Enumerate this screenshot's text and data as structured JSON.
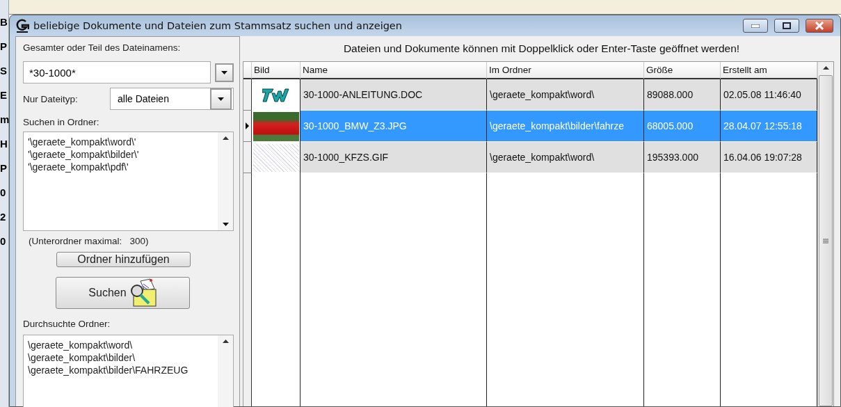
{
  "background_app": {
    "edge_letters": [
      "B",
      "P",
      "S",
      "E",
      "m",
      "H",
      "P",
      "0",
      "2",
      "0"
    ]
  },
  "window": {
    "title": "beliebige Dokumente und Dateien zum Stammsatz suchen und anzeigen"
  },
  "search_panel": {
    "name_label": "Gesamter oder Teil des Dateinamens:",
    "name_value": "*30-1000*",
    "type_label": "Nur Dateityp:",
    "type_value": "alle Dateien",
    "folders_label": "Suchen in Ordner:",
    "folders": [
      "'\\geraete_kompakt\\word\\'",
      "'\\geraete_kompakt\\bilder\\'",
      "'\\geraete_kompakt\\pdf\\'"
    ],
    "subfolder_note": "(Unterordner maximal:   300)",
    "add_button": "Ordner hinzufügen",
    "search_button": "Suchen",
    "searched_label": "Durchsuchte Ordner:",
    "searched_folders": [
      "\\geraete_kompakt\\word\\",
      "\\geraete_kompakt\\bilder\\",
      "\\geraete_kompakt\\bilder\\FAHRZEUG"
    ]
  },
  "results": {
    "hint": "Dateien und Dokumente können mit Doppelklick oder Enter-Taste geöffnet werden!",
    "columns": [
      "Bild",
      "Name",
      "Im Ordner",
      "Größe",
      "Erstellt am"
    ],
    "rows": [
      {
        "kind": "logo",
        "name": "30-1000-ANLEITUNG.DOC",
        "folder": "\\geraete_kompakt\\word\\",
        "size": "89088.000",
        "created": "02.05.08 11:46:40",
        "selected": false
      },
      {
        "kind": "photo",
        "name": "30-1000_BMW_Z3.JPG",
        "folder": "\\geraete_kompakt\\bilder\\fahrze",
        "size": "68005.000",
        "created": "28.04.07 12:55:18",
        "selected": true
      },
      {
        "kind": "scan",
        "name": "30-1000_KFZS.GIF",
        "folder": "\\geraete_kompakt\\word\\",
        "size": "195393.000",
        "created": "16.04.06 19:07:28",
        "selected": false
      }
    ]
  }
}
